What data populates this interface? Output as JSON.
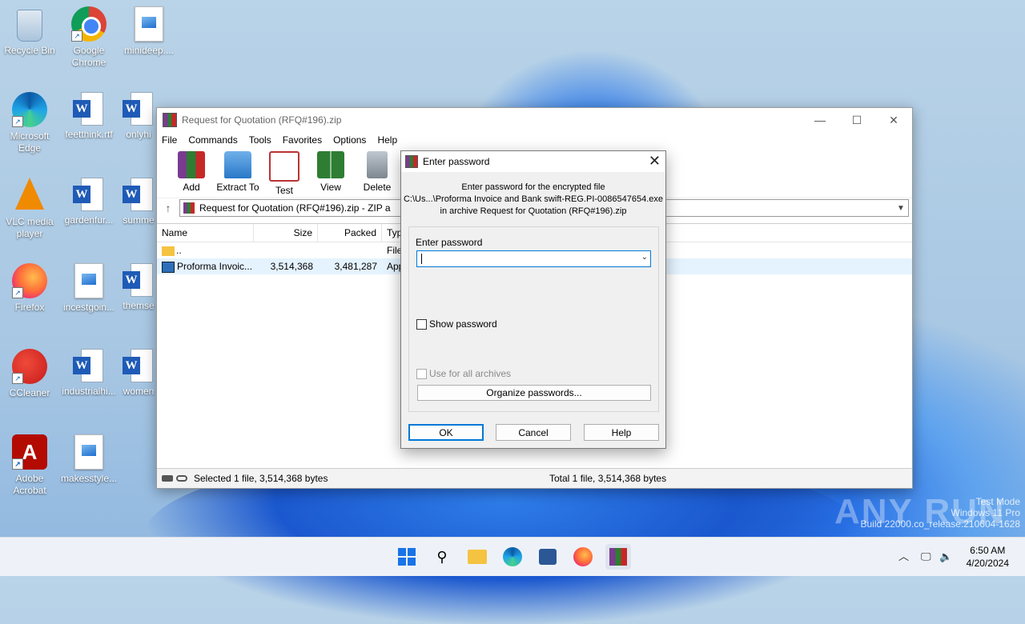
{
  "desktop": {
    "col1": [
      "Recycle Bin",
      "Microsoft Edge",
      "VLC media player",
      "Firefox",
      "CCleaner",
      "Adobe Acrobat"
    ],
    "col2": [
      "Google Chrome",
      "feetthink.rtf",
      "gardenfur...",
      "incestgoin...",
      "industrialhi...",
      "makesstyle..."
    ],
    "col3": [
      "minideep....",
      "onlyhi",
      "summe",
      "themse",
      "women"
    ]
  },
  "winrar": {
    "title": "Request for Quotation (RFQ#196).zip",
    "menu": [
      "File",
      "Commands",
      "Tools",
      "Favorites",
      "Options",
      "Help"
    ],
    "tools": [
      "Add",
      "Extract To",
      "Test",
      "View",
      "Delete"
    ],
    "address": "Request for Quotation (RFQ#196).zip - ZIP a",
    "columns": [
      "Name",
      "Size",
      "Packed",
      "Typ"
    ],
    "rows": [
      {
        "name": "..",
        "size": "",
        "packed": "",
        "type": "File"
      },
      {
        "name": "Proforma Invoic...",
        "size": "3,514,368",
        "packed": "3,481,287",
        "type": "App"
      }
    ],
    "status_left": "Selected 1 file, 3,514,368 bytes",
    "status_right": "Total 1 file, 3,514,368 bytes"
  },
  "dialog": {
    "title": "Enter password",
    "info1": "Enter password for the encrypted file",
    "info2": "C:\\Us...\\Proforma Invoice and Bank swift-REG.PI-0086547654.exe",
    "info3": "in archive Request for Quotation (RFQ#196).zip",
    "password_label": "Enter password",
    "password_value": "",
    "show_password": "Show password",
    "use_all": "Use for all archives",
    "organize": "Organize passwords...",
    "ok": "OK",
    "cancel": "Cancel",
    "help": "Help"
  },
  "watermark": {
    "brand": "ANY RUN",
    "line1": "Test Mode",
    "line2": "Windows 11 Pro",
    "line3": "Build 22000.co_release.210604-1628"
  },
  "taskbar": {
    "time": "6:50 AM",
    "date": "4/20/2024"
  },
  "colors": {
    "accent": "#0078d7",
    "taskbar": "#eef2f8"
  }
}
